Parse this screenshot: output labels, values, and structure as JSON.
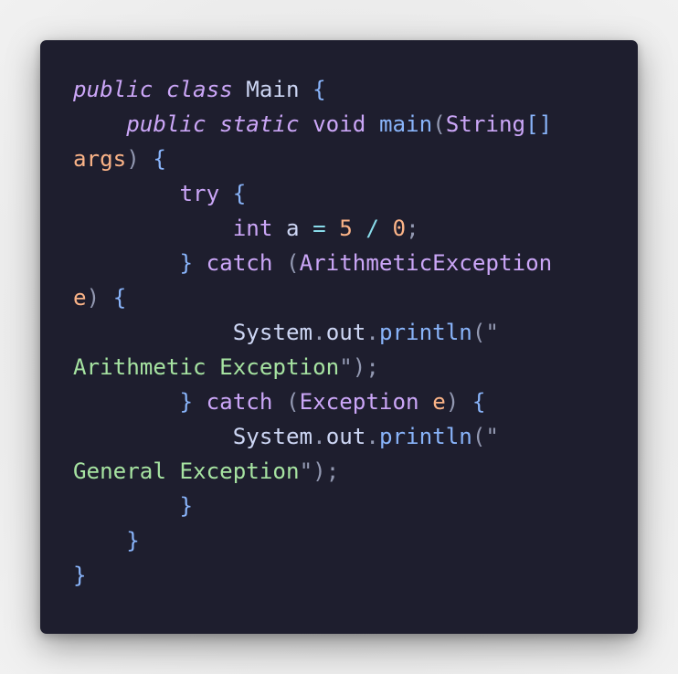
{
  "code": {
    "language": "java",
    "lines": [
      [
        {
          "text": "public",
          "cls": "kw-it"
        },
        {
          "text": " ",
          "cls": "plain"
        },
        {
          "text": "class",
          "cls": "kw-it"
        },
        {
          "text": " Main ",
          "cls": "plain"
        },
        {
          "text": "{",
          "cls": "brace"
        }
      ],
      [
        {
          "text": "    ",
          "cls": "plain"
        },
        {
          "text": "public",
          "cls": "kw-it"
        },
        {
          "text": " ",
          "cls": "plain"
        },
        {
          "text": "static",
          "cls": "kw-it"
        },
        {
          "text": " ",
          "cls": "plain"
        },
        {
          "text": "void",
          "cls": "kw"
        },
        {
          "text": " ",
          "cls": "plain"
        },
        {
          "text": "main",
          "cls": "fn"
        },
        {
          "text": "(",
          "cls": "punc"
        },
        {
          "text": "String",
          "cls": "type"
        },
        {
          "text": "[]",
          "cls": "brace"
        }
      ],
      [
        {
          "text": "args",
          "cls": "param"
        },
        {
          "text": ")",
          "cls": "punc"
        },
        {
          "text": " ",
          "cls": "plain"
        },
        {
          "text": "{",
          "cls": "brace"
        }
      ],
      [
        {
          "text": "        ",
          "cls": "plain"
        },
        {
          "text": "try",
          "cls": "kw"
        },
        {
          "text": " ",
          "cls": "plain"
        },
        {
          "text": "{",
          "cls": "brace"
        }
      ],
      [
        {
          "text": "            ",
          "cls": "plain"
        },
        {
          "text": "int",
          "cls": "kw"
        },
        {
          "text": " a ",
          "cls": "plain"
        },
        {
          "text": "=",
          "cls": "op"
        },
        {
          "text": " ",
          "cls": "plain"
        },
        {
          "text": "5",
          "cls": "num"
        },
        {
          "text": " ",
          "cls": "plain"
        },
        {
          "text": "/",
          "cls": "op"
        },
        {
          "text": " ",
          "cls": "plain"
        },
        {
          "text": "0",
          "cls": "num"
        },
        {
          "text": ";",
          "cls": "punc"
        }
      ],
      [
        {
          "text": "        ",
          "cls": "plain"
        },
        {
          "text": "}",
          "cls": "brace"
        },
        {
          "text": " ",
          "cls": "plain"
        },
        {
          "text": "catch",
          "cls": "kw"
        },
        {
          "text": " ",
          "cls": "plain"
        },
        {
          "text": "(",
          "cls": "punc"
        },
        {
          "text": "ArithmeticException",
          "cls": "type"
        }
      ],
      [
        {
          "text": "e",
          "cls": "param"
        },
        {
          "text": ")",
          "cls": "punc"
        },
        {
          "text": " ",
          "cls": "plain"
        },
        {
          "text": "{",
          "cls": "brace"
        }
      ],
      [
        {
          "text": "            System",
          "cls": "plain"
        },
        {
          "text": ".",
          "cls": "punc"
        },
        {
          "text": "out",
          "cls": "plain"
        },
        {
          "text": ".",
          "cls": "punc"
        },
        {
          "text": "println",
          "cls": "fn"
        },
        {
          "text": "(\"",
          "cls": "punc"
        }
      ],
      [
        {
          "text": "Arithmetic Exception",
          "cls": "str"
        },
        {
          "text": "\")",
          "cls": "punc"
        },
        {
          "text": ";",
          "cls": "punc"
        }
      ],
      [
        {
          "text": "        ",
          "cls": "plain"
        },
        {
          "text": "}",
          "cls": "brace"
        },
        {
          "text": " ",
          "cls": "plain"
        },
        {
          "text": "catch",
          "cls": "kw"
        },
        {
          "text": " ",
          "cls": "plain"
        },
        {
          "text": "(",
          "cls": "punc"
        },
        {
          "text": "Exception",
          "cls": "type"
        },
        {
          "text": " ",
          "cls": "plain"
        },
        {
          "text": "e",
          "cls": "param"
        },
        {
          "text": ")",
          "cls": "punc"
        },
        {
          "text": " ",
          "cls": "plain"
        },
        {
          "text": "{",
          "cls": "brace"
        }
      ],
      [
        {
          "text": "            System",
          "cls": "plain"
        },
        {
          "text": ".",
          "cls": "punc"
        },
        {
          "text": "out",
          "cls": "plain"
        },
        {
          "text": ".",
          "cls": "punc"
        },
        {
          "text": "println",
          "cls": "fn"
        },
        {
          "text": "(\"",
          "cls": "punc"
        }
      ],
      [
        {
          "text": "General Exception",
          "cls": "str"
        },
        {
          "text": "\")",
          "cls": "punc"
        },
        {
          "text": ";",
          "cls": "punc"
        }
      ],
      [
        {
          "text": "        ",
          "cls": "plain"
        },
        {
          "text": "}",
          "cls": "brace"
        }
      ],
      [
        {
          "text": "    ",
          "cls": "plain"
        },
        {
          "text": "}",
          "cls": "brace"
        }
      ],
      [
        {
          "text": "}",
          "cls": "brace"
        }
      ]
    ]
  },
  "colors": {
    "card_background": "#1e1e2e",
    "page_background": "#ebebeb",
    "keyword": "#cba6f7",
    "function": "#89b4fa",
    "string": "#a6e3a1",
    "number": "#fab387",
    "text": "#cdd6f4"
  }
}
